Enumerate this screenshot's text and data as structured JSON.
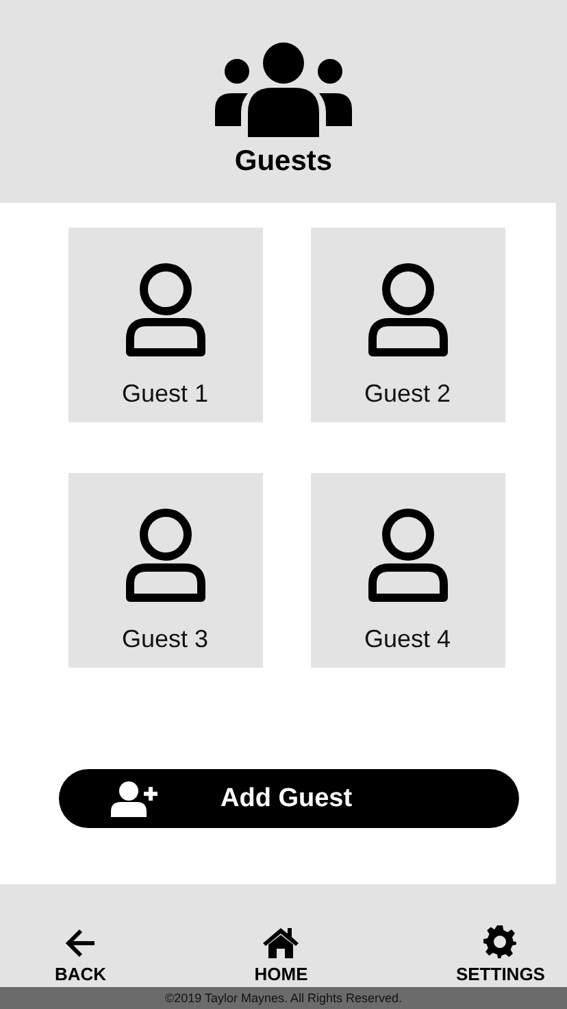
{
  "header": {
    "title": "Guests"
  },
  "guests": [
    {
      "name": "Guest 1"
    },
    {
      "name": "Guest 2"
    },
    {
      "name": "Guest 3"
    },
    {
      "name": "Guest 4"
    }
  ],
  "add_button": {
    "label": "Add Guest"
  },
  "nav": [
    {
      "kind": "back",
      "label": "BACK"
    },
    {
      "kind": "home",
      "label": "HOME"
    },
    {
      "kind": "settings",
      "label": "SETTINGS"
    }
  ],
  "footer": {
    "copyright": "©2019 Taylor Maynes. All Rights Reserved."
  }
}
